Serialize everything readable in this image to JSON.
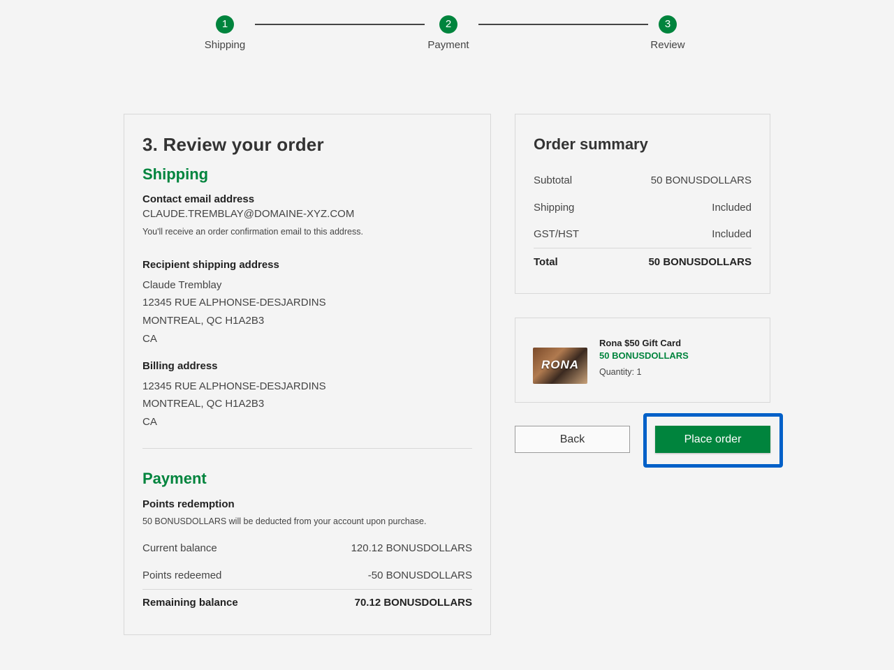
{
  "stepper": {
    "steps": [
      {
        "number": "1",
        "label": "Shipping"
      },
      {
        "number": "2",
        "label": "Payment"
      },
      {
        "number": "3",
        "label": "Review"
      }
    ]
  },
  "review": {
    "title": "3. Review your order",
    "shipping_heading": "Shipping",
    "contact_label": "Contact email address",
    "contact_email": "CLAUDE.TREMBLAY@DOMAINE-XYZ.COM",
    "contact_note": "You'll receive an order confirmation email to this address.",
    "recipient_label": "Recipient shipping address",
    "recipient_lines": [
      "Claude Tremblay",
      "12345 RUE ALPHONSE-DESJARDINS",
      "MONTREAL, QC H1A2B3",
      "CA"
    ],
    "billing_label": "Billing address",
    "billing_lines": [
      "12345 RUE ALPHONSE-DESJARDINS",
      "MONTREAL, QC H1A2B3",
      "CA"
    ],
    "payment_heading": "Payment",
    "points_label": "Points redemption",
    "points_note": "50 BONUSDOLLARS will be deducted from your account upon purchase.",
    "balance_rows": [
      {
        "label": "Current balance",
        "value": "120.12 BONUSDOLLARS"
      },
      {
        "label": "Points redeemed",
        "value": "-50 BONUSDOLLARS"
      }
    ],
    "remaining": {
      "label": "Remaining balance",
      "value": "70.12 BONUSDOLLARS"
    }
  },
  "summary": {
    "title": "Order summary",
    "rows": [
      {
        "label": "Subtotal",
        "value": "50 BONUSDOLLARS"
      },
      {
        "label": "Shipping",
        "value": "Included"
      },
      {
        "label": "GST/HST",
        "value": "Included"
      }
    ],
    "total": {
      "label": "Total",
      "value": "50 BONUSDOLLARS"
    }
  },
  "item": {
    "name": "Rona $50 Gift Card",
    "price": "50 BONUSDOLLARS",
    "quantity": "Quantity: 1",
    "thumb_brand": "RONA"
  },
  "actions": {
    "back_label": "Back",
    "place_label": "Place order"
  },
  "colors": {
    "accent": "#00843d",
    "highlight": "#0060c8"
  }
}
